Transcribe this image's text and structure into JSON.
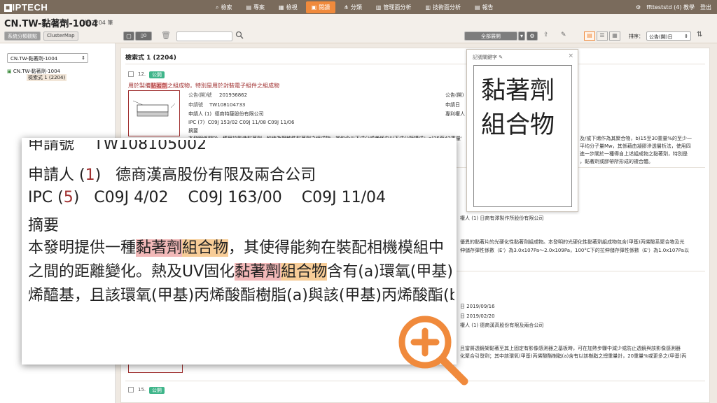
{
  "app": {
    "logo": "IPTECH"
  },
  "nav": [
    {
      "label": "檢索",
      "icon": "search-icon"
    },
    {
      "label": "專案",
      "icon": "folder-icon"
    },
    {
      "label": "檢視",
      "icon": "view-icon"
    },
    {
      "label": "閱讀",
      "icon": "read-icon",
      "active": true
    },
    {
      "label": "分類",
      "icon": "tree-icon"
    },
    {
      "label": "管理面分析",
      "icon": "chart-icon"
    },
    {
      "label": "技術面分析",
      "icon": "chart-icon"
    },
    {
      "label": "報告",
      "icon": "report-icon"
    }
  ],
  "user": {
    "name": "fftteststd (4) 教學",
    "logout": "登出"
  },
  "header": {
    "title": "CN.TW-黏著劑-1004",
    "count": "共 2204 筆"
  },
  "toolbar": {
    "view_a": "系統分類觀點",
    "view_b": "ClusterMap",
    "selected_count": "0",
    "expand_label": "全部展開",
    "sort_label": "排序：",
    "sort_value": "公告(開)日"
  },
  "left": {
    "dropdown": "CN.TW-黏著劑-1004",
    "tree_root": "CN.TW-黏著劑-1004",
    "tree_child": "檢索式 1 (2204)"
  },
  "main": {
    "section_title": "檢索式 1 (2204)",
    "item12": {
      "num": "12.",
      "badge": "公開",
      "title_a": "用於製備",
      "title_hl": "黏著劑",
      "title_b": "之組成物，特別是用於封裝電子組件之組成物",
      "pub_label": "公告(開)號",
      "pub_value": "201936862",
      "app_label": "申請號",
      "app_value": "TW108104733",
      "applicant_label": "申請人 (1)",
      "applicant_value": "德商特薩股份有限公司",
      "ipc_label": "IPC (7)",
      "ipc_values": "C09J 153/02    C09J 11/08    C09J 11/06",
      "abstract_label": "摘要",
      "abstract": "本發明係關於一種用於製造黏著劑，較佳為壓敏性黏著劑之組成物，其包含以下成分或者係由以下成分所構成：a)25至42重量%...",
      "right1": "公告(開)",
      "right2": "申請日",
      "right3": "專利權人",
      "r_frag1": "及/或下烯作為其聚合物，b)15至30重量%的至少一",
      "r_frag2": "平均分子量Mw，其係藉由凝膠滲透層析法，使用四",
      "r_frag3": "進一步關於一種得自上述組成物之黏著劑，特別是",
      "r_frag4": "，黏著劑或膠帶所形成的複合體。"
    },
    "item13": {
      "r_owner": "權人 (1)   日商有澤製作所股份有限公司",
      "r_abs1": "優異的黏著片的光硬化性黏著劑組成物。本發明的光硬化性黏著劑組成物包含(甲基)丙烯酸系聚合物及光",
      "r_abs2": "伸儲存彈性係數（E'）為3.0x107Pa～2.0x109Pa，100°C下的拉伸儲存彈性係數（E'）為1.0x107Pa以"
    },
    "item14": {
      "r_date1": "日   2019/09/16",
      "r_date2": "日   2019/02/20",
      "r_owner": "權人 (1)   德商漢高股份有限及兩合公司",
      "r_abs1": "且當將透鏡架黏著至其上固定有影像感測器之基板時，可在加熱步驟中減少或防止透鏡與該影像感測器",
      "r_abs2": "化聚合引發劑；其中該環氧(甲基)丙烯酸酯樹脂(a)含有以該樹脂之總重量計，20重量%或更多之(甲基)丙"
    },
    "item15": {
      "num": "15.",
      "badge": "公開"
    }
  },
  "keyword_popup": {
    "header": "記號關鍵字",
    "close": "×",
    "text": "黏著劑組合物"
  },
  "zoom": {
    "top_cut_label": "申請號",
    "top_cut_value": "TW108105002",
    "applicant_label_a": "申請人 (",
    "applicant_count": "1",
    "applicant_label_b": ")",
    "applicant_value": "德商漢高股份有限及兩合公司",
    "ipc_label_a": "IPC (",
    "ipc_count": "5",
    "ipc_label_b": ")",
    "ipc_1": "C09J 4/02",
    "ipc_2": "C09J 163/00",
    "ipc_3": "C09J 11/04",
    "abstract_label": "摘要",
    "line1_a": "本發明提供一種",
    "line1_hl1": "黏著劑",
    "line1_hl2": "組合物",
    "line1_b": "，其使得能夠在裝配相機模組中",
    "line2_a": "之間的距離變化。熱及UV固化",
    "line2_hl1": "黏著劑",
    "line2_hl2": "組合物",
    "line2_b": "含有(a)環氧(甲基)",
    "line3": "烯醯基，且該環氧(甲基)丙烯酸酯樹脂(a)與該(甲基)丙烯酸酯(b"
  },
  "colors": {
    "accent": "#f08a3c",
    "topbar": "#7a6b5c",
    "badge": "#3fb58a",
    "highlight_red": "#f2b8b8",
    "highlight_orange": "#f7cc97"
  }
}
